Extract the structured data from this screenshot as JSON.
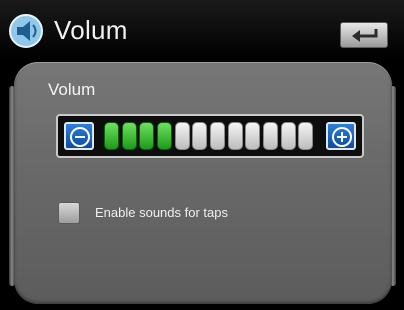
{
  "header": {
    "title": "Volum",
    "app_icon": "speaker-icon",
    "back_icon": "back-arrow-icon"
  },
  "volume": {
    "label": "Volum",
    "level": 4,
    "max": 12,
    "decrease_icon": "minus-circle-icon",
    "increase_icon": "plus-circle-icon"
  },
  "settings": {
    "tap_sounds_label": "Enable sounds for taps",
    "tap_sounds_checked": false
  },
  "colors": {
    "panel": "#6a6a6a",
    "active_segment": "#3ec033",
    "inactive_segment": "#e0e0e0",
    "button_blue": "#1f64c0"
  }
}
